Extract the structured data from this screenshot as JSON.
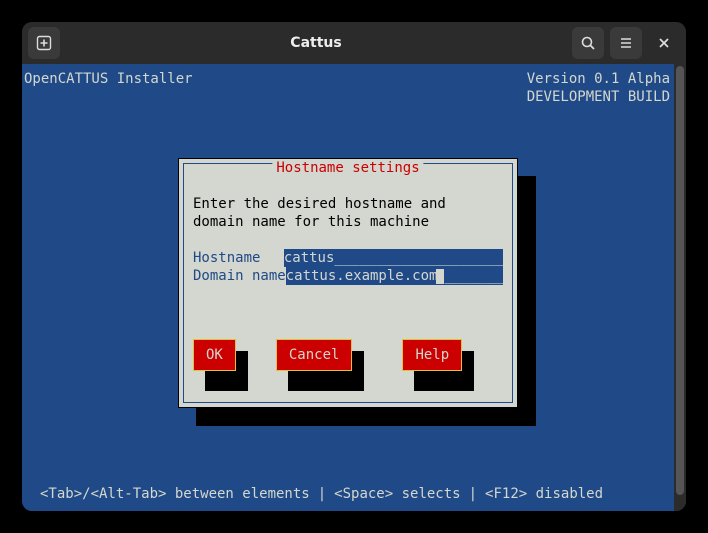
{
  "window": {
    "title": "Cattus"
  },
  "header": {
    "left": "OpenCATTUS Installer",
    "right_line1": "Version 0.1 Alpha",
    "right_line2": "DEVELOPMENT BUILD"
  },
  "dialog": {
    "title": "Hostname settings",
    "instruction": "Enter the desired hostname and domain name for this machine",
    "fields": [
      {
        "label": "Hostname",
        "value": "cattus"
      },
      {
        "label": "Domain name",
        "value": "cattus.example.com"
      }
    ],
    "buttons": {
      "ok": "OK",
      "cancel": "Cancel",
      "help": "Help"
    }
  },
  "footer": {
    "hint_tab": "<Tab>/<Alt-Tab> between elements",
    "hint_space": "<Space> selects",
    "hint_f12": "<F12> disabled",
    "sep": "|"
  }
}
